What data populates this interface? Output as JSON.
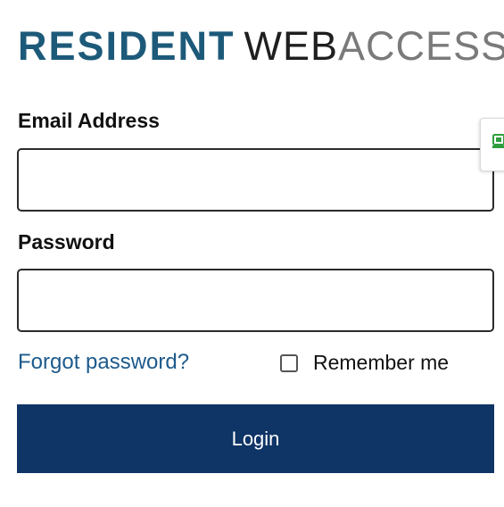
{
  "logo": {
    "part1": "RESIDENT",
    "part2": "WEB",
    "part3": "ACCESS"
  },
  "form": {
    "email_label": "Email Address",
    "email_value": "",
    "password_label": "Password",
    "password_value": "",
    "forgot_link": "Forgot password?",
    "remember_label": "Remember me",
    "remember_checked": false,
    "login_button": "Login"
  },
  "side_tab": {
    "icon": "green-extension-icon"
  },
  "colors": {
    "brand_teal": "#1d5a7a",
    "button_navy": "#0f3466",
    "link_blue": "#1d5a8c",
    "icon_green": "#2e9e3e"
  }
}
